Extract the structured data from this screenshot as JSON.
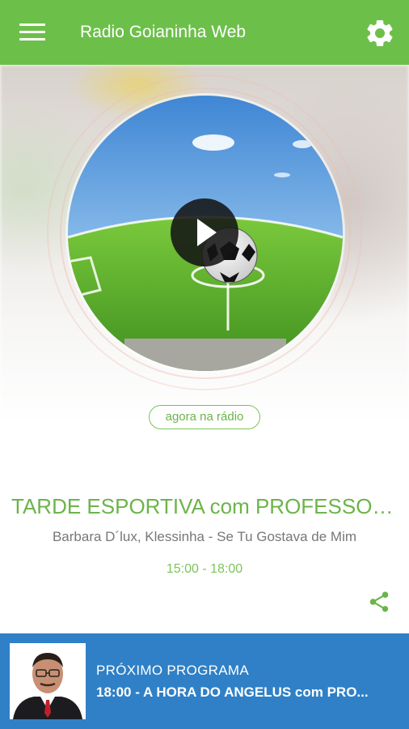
{
  "app": {
    "title": "Radio Goianinha Web"
  },
  "header": {
    "menu_icon": "hamburger-menu-icon",
    "settings_icon": "gear-icon"
  },
  "now_playing": {
    "badge": "agora na rádio",
    "program_title": "TARDE ESPORTIVA com PROFESSOR...",
    "track": "Barbara D´lux, Klessinha - Se Tu Gostava de Mim",
    "time": "15:00 - 18:00",
    "share_icon": "share-icon",
    "play_icon": "play-icon"
  },
  "next_program": {
    "label": "PRÓXIMO PROGRAMA",
    "title": "18:00 - A HORA DO ANGELUS com PRO..."
  },
  "colors": {
    "primary_green": "#6cc04a",
    "text_green": "#6cb44a",
    "next_bar_blue": "#2f80c6"
  }
}
